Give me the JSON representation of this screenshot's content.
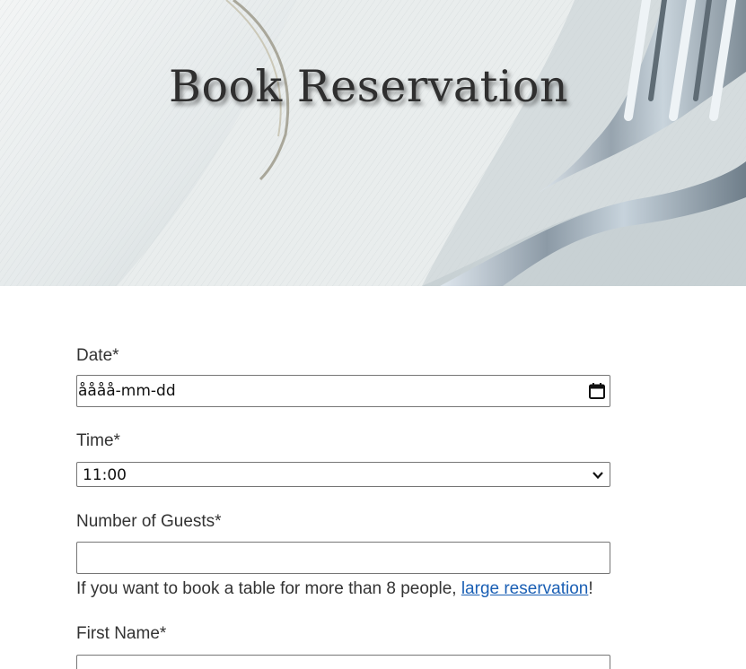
{
  "hero": {
    "title": "Book Reservation"
  },
  "form": {
    "date": {
      "label": "Date*",
      "value": "åååå-mm-dd",
      "icon": "calendar-icon"
    },
    "time": {
      "label": "Time*",
      "value": "11:00",
      "icon": "chevron-down-icon"
    },
    "guests": {
      "label": "Number of Guests*",
      "value": "",
      "help_prefix": "If you want to book a table for more than 8 people, ",
      "help_link": "large reservation",
      "help_suffix": "!"
    },
    "first_name": {
      "label": "First Name*",
      "value": ""
    }
  },
  "colors": {
    "link": "#1a5fb4",
    "border": "#767676",
    "text": "#333333"
  }
}
